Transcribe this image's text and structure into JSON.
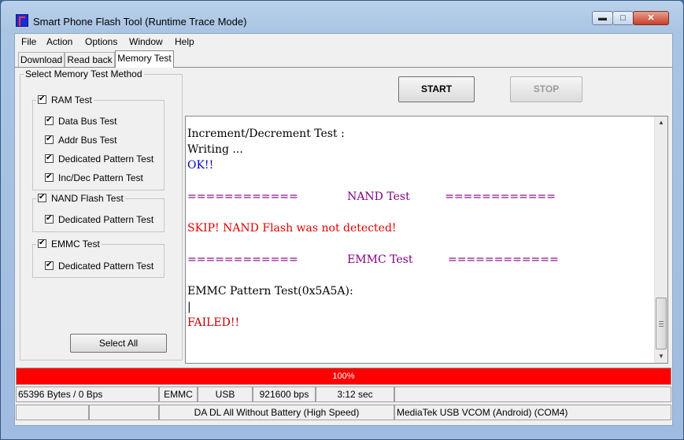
{
  "window": {
    "title": "Smart Phone Flash Tool (Runtime Trace Mode)",
    "min_glyph": "▬",
    "max_glyph": "□",
    "close_glyph": "✕"
  },
  "menu": [
    "File",
    "Action",
    "Options",
    "Window",
    "Help"
  ],
  "tabs": [
    "Download",
    "Read back",
    "Memory Test"
  ],
  "active_tab": "Memory Test",
  "method_group": {
    "title": "Select Memory Test Method",
    "ram": {
      "label": "RAM Test",
      "items": [
        "Data Bus Test",
        "Addr Bus Test",
        "Dedicated Pattern Test",
        "Inc/Dec Pattern Test"
      ]
    },
    "nand": {
      "label": "NAND Flash Test",
      "items": [
        "Dedicated Pattern Test"
      ]
    },
    "emmc": {
      "label": "EMMC Test",
      "items": [
        "Dedicated Pattern Test"
      ]
    },
    "select_all": "Select All"
  },
  "buttons": {
    "start": "START",
    "stop": "STOP"
  },
  "log": [
    {
      "text": "Increment/Decrement Test :",
      "color": "#000000"
    },
    {
      "text": "Writing ...",
      "color": "#000000"
    },
    {
      "text": "OK!!",
      "color": "#0000c0"
    },
    {
      "text": "",
      "color": "#000000"
    },
    {
      "text": "============              NAND Test          ============",
      "color": "#800080"
    },
    {
      "text": "",
      "color": "#000000"
    },
    {
      "text": "SKIP! NAND Flash was not detected!",
      "color": "#e00000"
    },
    {
      "text": "",
      "color": "#000000"
    },
    {
      "text": "============              EMMC Test          ============",
      "color": "#800080"
    },
    {
      "text": "",
      "color": "#000000"
    },
    {
      "text": "EMMC Pattern Test(0x5A5A):",
      "color": "#000000"
    },
    {
      "text": "|",
      "color": "#000000"
    },
    {
      "text": "FAILED!!",
      "color": "#c00000"
    }
  ],
  "progress": {
    "percent": 100,
    "text": "100%",
    "color": "#ff0000"
  },
  "status": {
    "row1": [
      "65396 Bytes / 0 Bps",
      "EMMC",
      "USB",
      "921600 bps",
      "3:12 sec",
      ""
    ],
    "row2": [
      "",
      "",
      "DA DL All Without Battery (High Speed)",
      "MediaTek USB VCOM (Android) (COM4)"
    ]
  }
}
